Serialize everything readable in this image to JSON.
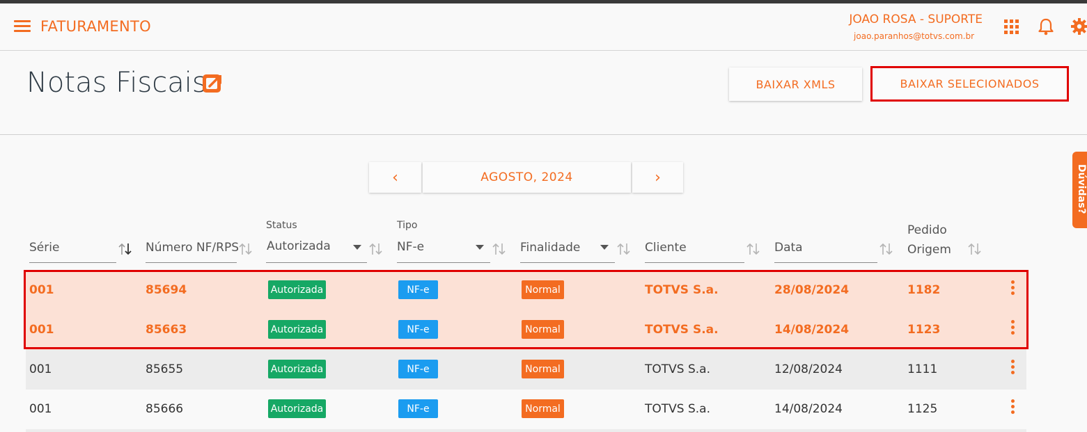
{
  "header": {
    "app_title": "FATURAMENTO",
    "user_name": "JOAO ROSA - SUPORTE",
    "user_email": "joao.paranhos@totvs.com.br",
    "icons": [
      "menu-icon",
      "apps-grid-icon",
      "bell-icon",
      "gear-icon"
    ]
  },
  "page": {
    "title": "Notas Fiscais",
    "baixar_xmls": "BAIXAR XMLS",
    "baixar_selecionados": "BAIXAR SELECIONADOS"
  },
  "month_nav": {
    "prev": "‹",
    "label": "AGOSTO, 2024",
    "next": "›"
  },
  "table": {
    "columns": {
      "serie": "Série",
      "numero": "Número NF/RPS",
      "status_label": "Status",
      "status_value": "Autorizada",
      "tipo_label": "Tipo",
      "tipo_value": "NF-e",
      "finalidade": "Finalidade",
      "cliente": "Cliente",
      "data": "Data",
      "pedido_line1": "Pedido",
      "pedido_line2": "Origem"
    },
    "rows": [
      {
        "serie": "001",
        "numero": "85694",
        "status": "Autorizada",
        "tipo": "NF-e",
        "finalidade": "Normal",
        "cliente": "TOTVS S.a.",
        "data": "28/08/2024",
        "pedido": "1182",
        "selected": true
      },
      {
        "serie": "001",
        "numero": "85663",
        "status": "Autorizada",
        "tipo": "NF-e",
        "finalidade": "Normal",
        "cliente": "TOTVS S.a.",
        "data": "14/08/2024",
        "pedido": "1123",
        "selected": true
      },
      {
        "serie": "001",
        "numero": "85655",
        "status": "Autorizada",
        "tipo": "NF-e",
        "finalidade": "Normal",
        "cliente": "TOTVS S.a.",
        "data": "12/08/2024",
        "pedido": "1111",
        "selected": false
      },
      {
        "serie": "001",
        "numero": "85666",
        "status": "Autorizada",
        "tipo": "NF-e",
        "finalidade": "Normal",
        "cliente": "TOTVS S.a.",
        "data": "14/08/2024",
        "pedido": "1125",
        "selected": false
      }
    ]
  },
  "help_tab": "Dúvidas?",
  "colors": {
    "accent": "#f36c21",
    "status_green": "#16a865",
    "tipo_blue": "#1b9cf0",
    "selected_row_bg": "#fce1d6",
    "highlight_red": "#e00000"
  }
}
